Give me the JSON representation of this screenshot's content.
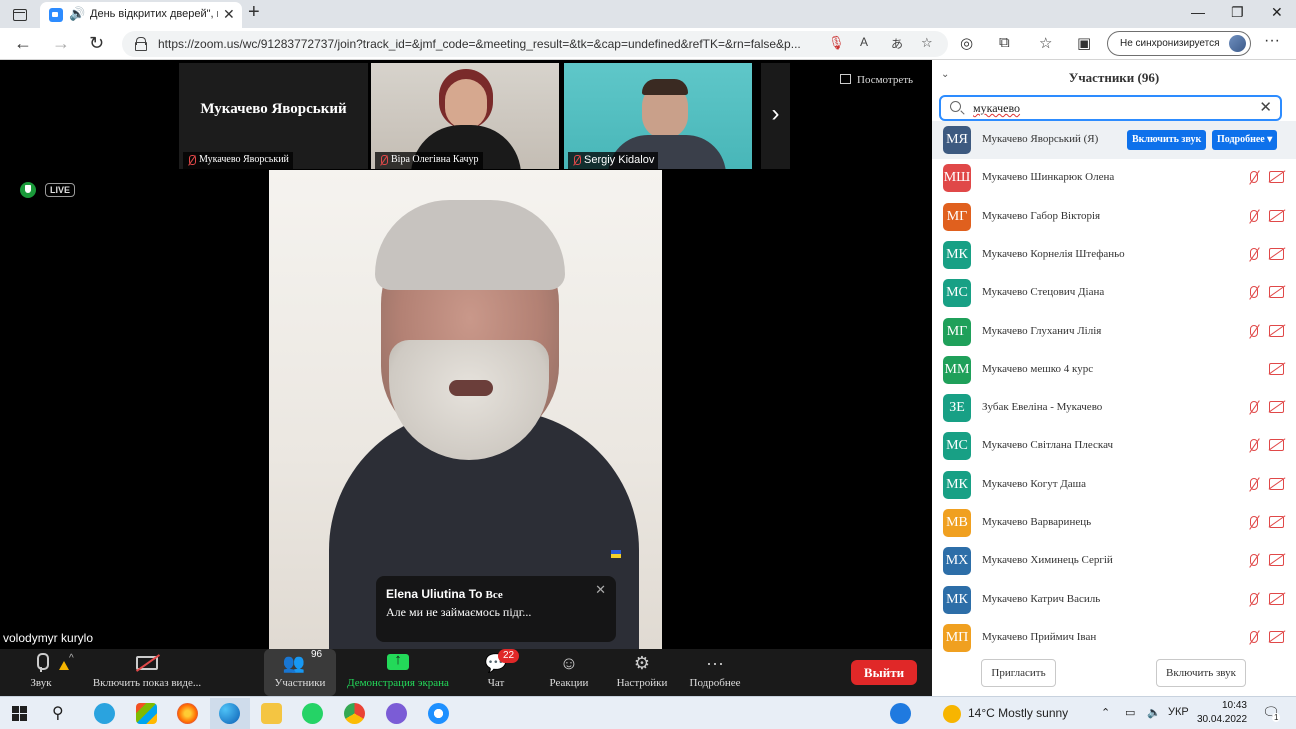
{
  "browser": {
    "tab_title": "День відкритих дверей\", к",
    "address_url": "https://zoom.us/wc/91283772737/join?track_id=&jmf_code=&meeting_result=&tk=&cap=undefined&refTK=&rn=false&p...",
    "sync_label": "Не синхронизируется"
  },
  "meeting": {
    "strip": [
      {
        "name": "Мукачево Яворський",
        "has_video": false
      },
      {
        "name": "Віра Олегівна Качур",
        "has_video": true
      },
      {
        "name": "Sergiy Kidalov",
        "has_video": true
      }
    ],
    "view_button": "Посмотреть",
    "live_badge": "LIVE",
    "chat_toast": {
      "from": "Elena Uliutina",
      "to_prefix": "To",
      "to": "Все",
      "message": "Але ми не займаємось підг..."
    },
    "self_name": "volodymyr kurylo"
  },
  "controls": {
    "audio_label": "Звук",
    "video_label": "Включить показ виде...",
    "participants_label": "Участники",
    "participants_count": "96",
    "share_label": "Демонстрация экрана",
    "chat_label": "Чат",
    "chat_badge": "22",
    "reactions_label": "Реакции",
    "settings_label": "Настройки",
    "more_label": "Подробнее",
    "leave_label": "Выйти"
  },
  "panel": {
    "title": "Участники (96)",
    "search_value": "мукачево",
    "mute_all_inline": "Включить звук",
    "more_inline": "Подробнее ▾",
    "invite_button": "Пригласить",
    "unmute_button": "Включить звук",
    "participants": [
      {
        "initials": "МЯ",
        "name": "Мукачево Яворський (Я)",
        "color": "#3d5a80",
        "selected": true
      },
      {
        "initials": "МШ",
        "name": "Мукачево Шинкарюк Олена",
        "color": "#e04848"
      },
      {
        "initials": "МГ",
        "name": "Мукачево Габор Вікторія",
        "color": "#e0601e"
      },
      {
        "initials": "МК",
        "name": "Мукачево Корнелія Штефаньо",
        "color": "#18a085"
      },
      {
        "initials": "МС",
        "name": "Мукачево Стецович Діана",
        "color": "#18a085"
      },
      {
        "initials": "МГ",
        "name": "Мукачево Глуханич Лілія",
        "color": "#1fa05a"
      },
      {
        "initials": "ММ",
        "name": "Мукачево мешко 4 курс",
        "color": "#1fa05a",
        "mic_hidden": true
      },
      {
        "initials": "ЗЕ",
        "name": "Зубак Евеліна - Мукачево",
        "color": "#18a085"
      },
      {
        "initials": "МС",
        "name": "Мукачево Світлана Плескач",
        "color": "#18a085"
      },
      {
        "initials": "МК",
        "name": "Мукачево Когут Даша",
        "color": "#18a085"
      },
      {
        "initials": "МВ",
        "name": "Мукачево Варваринець",
        "color": "#f0a020"
      },
      {
        "initials": "МХ",
        "name": "Мукачево Химинець Сергій",
        "color": "#2d6ea8"
      },
      {
        "initials": "МК",
        "name": "Мукачево Катрич Василь",
        "color": "#2d6ea8"
      },
      {
        "initials": "МП",
        "name": "Мукачево Приймич Іван",
        "color": "#f0a020"
      }
    ]
  },
  "taskbar": {
    "weather": "14°C  Mostly sunny",
    "language": "УКР",
    "time": "10:43",
    "date": "30.04.2022",
    "notification_count": "1"
  }
}
